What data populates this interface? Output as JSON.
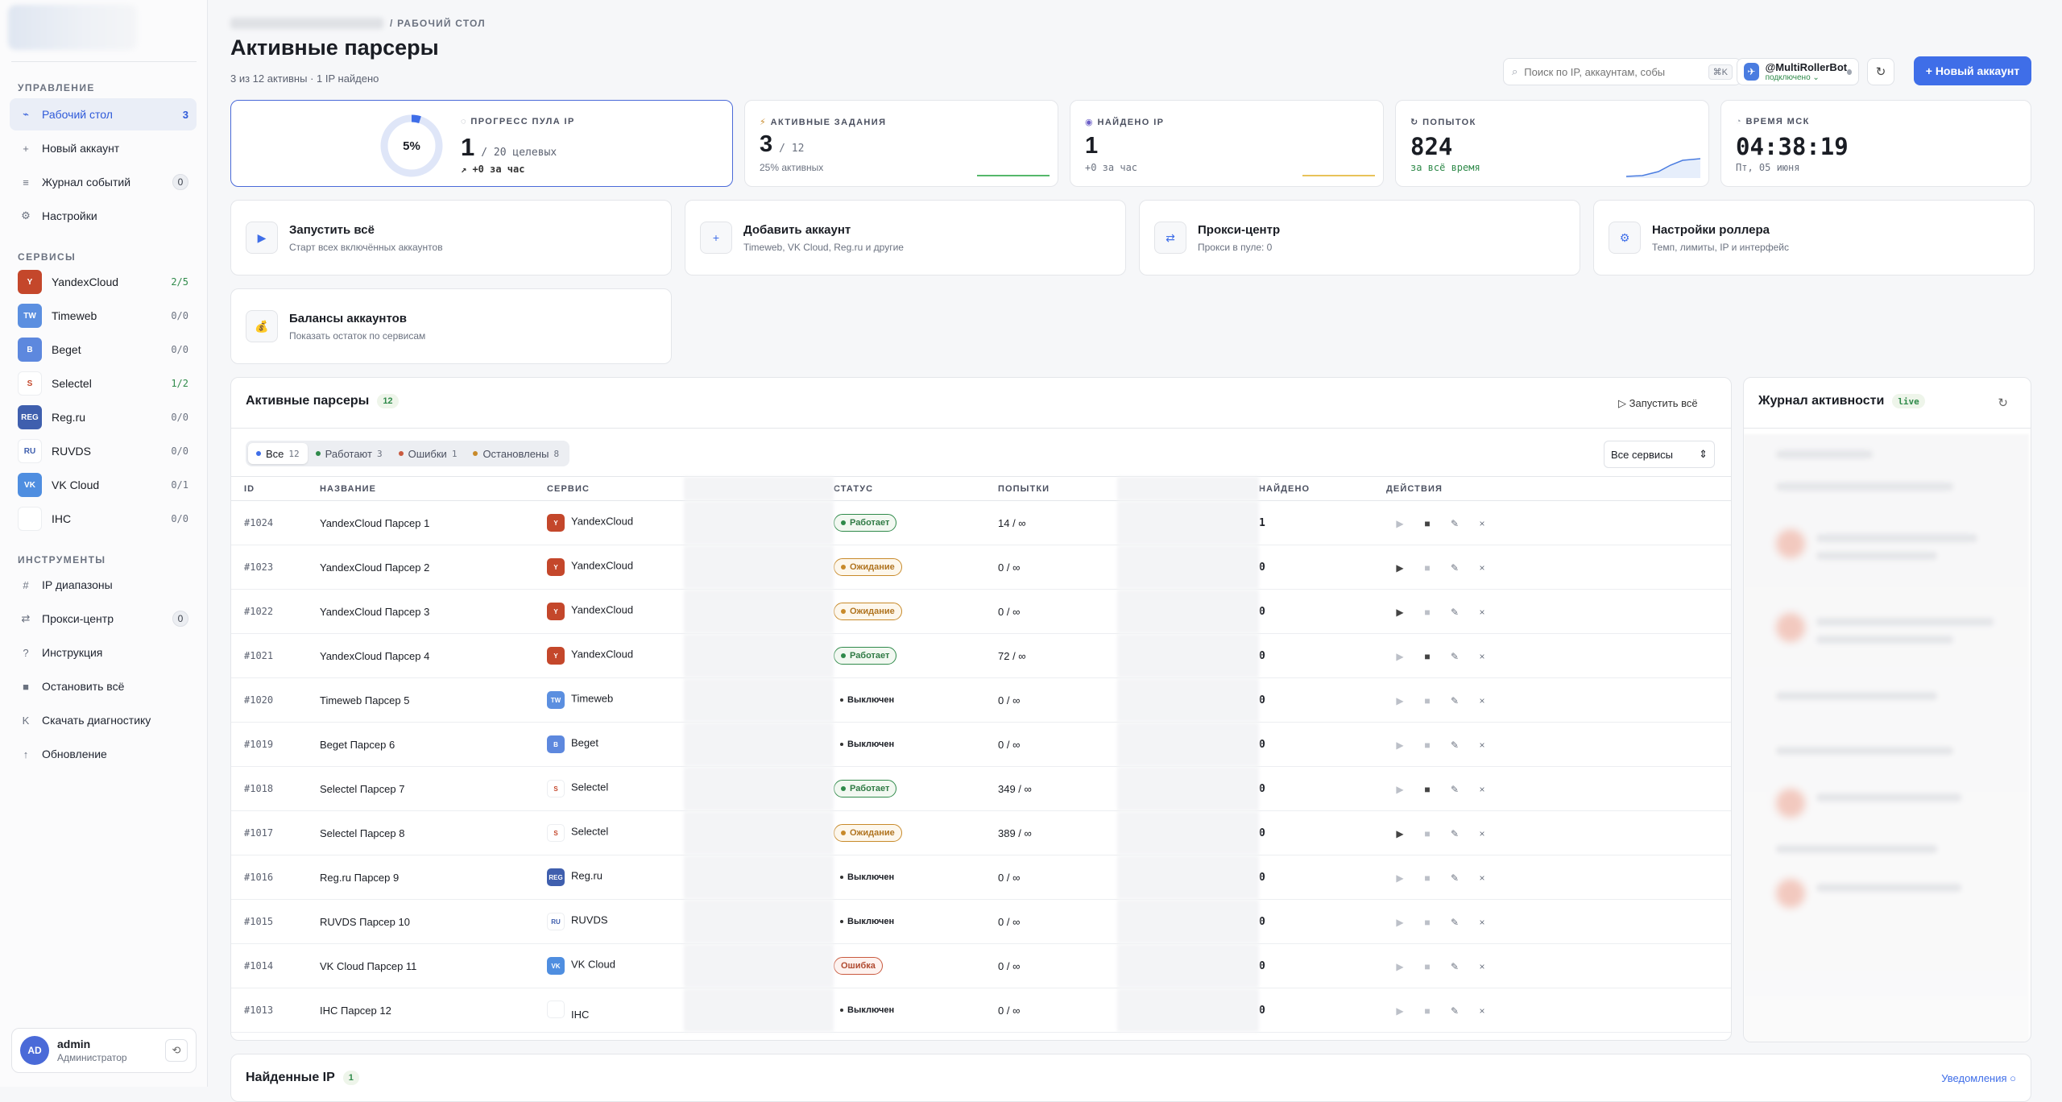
{
  "sidebar": {
    "sections": {
      "manage": "УПРАВЛЕНИЕ",
      "services": "СЕРВИСЫ",
      "tools": "ИНСТРУМЕНТЫ"
    },
    "manage_items": [
      {
        "label": "Рабочий стол",
        "icon": "⌁",
        "count": "3"
      },
      {
        "label": "Новый аккаунт",
        "icon": "+",
        "count": ""
      },
      {
        "label": "Журнал событий",
        "icon": "≡",
        "badge": "0"
      },
      {
        "label": "Настройки",
        "icon": "⚙",
        "count": ""
      }
    ],
    "services": [
      {
        "label": "YandexCloud",
        "abbr": "Y",
        "count": "2/5",
        "color": "#c4472b"
      },
      {
        "label": "Timeweb",
        "abbr": "TW",
        "count": "0/0",
        "color": "#5b8fe0"
      },
      {
        "label": "Beget",
        "abbr": "B",
        "count": "0/0",
        "color": "#5d88de"
      },
      {
        "label": "Selectel",
        "abbr": "S",
        "count": "1/2",
        "color": "#ffffff"
      },
      {
        "label": "Reg.ru",
        "abbr": "REG",
        "count": "0/0",
        "color": "#3f5fae"
      },
      {
        "label": "RUVDS",
        "abbr": "RU",
        "count": "0/0",
        "color": "#ffffff"
      },
      {
        "label": "VK Cloud",
        "abbr": "VK",
        "count": "0/1",
        "color": "#4f8ee0"
      },
      {
        "label": "IHC",
        "abbr": "",
        "count": "0/0",
        "color": "#ffffff"
      }
    ],
    "tools": [
      {
        "label": "IP диапазоны",
        "icon": "#"
      },
      {
        "label": "Прокси-центр",
        "icon": "⇄",
        "badge": "0"
      },
      {
        "label": "Инструкция",
        "icon": "?"
      },
      {
        "label": "Остановить всё",
        "icon": "■"
      },
      {
        "label": "Скачать диагностику",
        "icon": "K"
      },
      {
        "label": "Обновление",
        "icon": "↑"
      }
    ],
    "user": {
      "initials": "AD",
      "name": "admin",
      "role": "Администратор"
    }
  },
  "header": {
    "breadcrumb": "/ РАБОЧИЙ СТОЛ",
    "title": "Активные парсеры",
    "subtitle": "3 из 12 активны · 1 IP найдено",
    "search_placeholder": "Поиск по IP, аккаунтам, собы",
    "search_kbd": "⌘K",
    "bot_name": "@MultiRollerBot",
    "bot_status": "подключено ⌄",
    "new_account": "+ Новый аккаунт"
  },
  "stats": {
    "pool": {
      "label": "ПРОГРЕСС ПУЛА IP",
      "percent": "5%",
      "progress": 0.05,
      "value": "1",
      "target": "/ 20 целевых",
      "delta": "↗ +0 за час"
    },
    "tasks": {
      "label": "АКТИВНЫЕ ЗАДАНИЯ",
      "value": "3",
      "total": "/ 12",
      "sub": "25% активных"
    },
    "found": {
      "label": "НАЙДЕНО IP",
      "value": "1",
      "sub": "+0 за час"
    },
    "attempts": {
      "label": "ПОПЫТОК",
      "value": "824",
      "sub": "за всё время"
    },
    "time": {
      "label": "ВРЕМЯ МСК",
      "value": "04:38:19",
      "sub": "Пт, 05 июня"
    }
  },
  "tiles": [
    {
      "title": "Запустить всё",
      "desc": "Старт всех включённых аккаунтов",
      "icon": "▶"
    },
    {
      "title": "Добавить аккаунт",
      "desc": "Timeweb, VK Cloud, Reg.ru и другие",
      "icon": "+"
    },
    {
      "title": "Прокси-центр",
      "desc": "Прокси в пуле: 0",
      "icon": "⇄"
    },
    {
      "title": "Настройки роллера",
      "desc": "Темп, лимиты, IP и интерфейс",
      "icon": "⚙"
    },
    {
      "title": "Балансы аккаунтов",
      "desc": "Показать остаток по сервисам",
      "icon": "💰"
    }
  ],
  "parsers": {
    "title": "Активные парсеры",
    "count": "12",
    "run_all": "▷ Запустить всё",
    "filters": [
      {
        "label": "Все",
        "count": "12",
        "color": "#3f6ee8"
      },
      {
        "label": "Работают",
        "count": "3",
        "color": "#2f8a4a"
      },
      {
        "label": "Ошибки",
        "count": "1",
        "color": "#c95a3f"
      },
      {
        "label": "Остановлены",
        "count": "8",
        "color": "#c88a2a"
      }
    ],
    "service_select": "Все сервисы",
    "columns": [
      "ID",
      "НАЗВАНИЕ",
      "СЕРВИС",
      "",
      "СТАТУС",
      "ПОПЫТКИ",
      "",
      "НАЙДЕНО",
      "ДЕЙСТВИЯ"
    ],
    "rows": [
      {
        "id": "#1024",
        "name": "YandexCloud Парсер 1",
        "service": "YandexCloud",
        "abbr": "Y",
        "color": "#c4472b",
        "status": "Работает",
        "kind": "run",
        "attempts": "14 / ∞",
        "found": "1"
      },
      {
        "id": "#1023",
        "name": "YandexCloud Парсер 2",
        "service": "YandexCloud",
        "abbr": "Y",
        "color": "#c4472b",
        "status": "Ожидание",
        "kind": "wait",
        "attempts": "0 / ∞",
        "found": "0"
      },
      {
        "id": "#1022",
        "name": "YandexCloud Парсер 3",
        "service": "YandexCloud",
        "abbr": "Y",
        "color": "#c4472b",
        "status": "Ожидание",
        "kind": "wait",
        "attempts": "0 / ∞",
        "found": "0"
      },
      {
        "id": "#1021",
        "name": "YandexCloud Парсер 4",
        "service": "YandexCloud",
        "abbr": "Y",
        "color": "#c4472b",
        "status": "Работает",
        "kind": "run",
        "attempts": "72 / ∞",
        "found": "0"
      },
      {
        "id": "#1020",
        "name": "Timeweb Парсер 5",
        "service": "Timeweb",
        "abbr": "TW",
        "color": "#5b8fe0",
        "status": "Выключен",
        "kind": "off",
        "attempts": "0 / ∞",
        "found": "0"
      },
      {
        "id": "#1019",
        "name": "Beget Парсер 6",
        "service": "Beget",
        "abbr": "B",
        "color": "#5d88de",
        "status": "Выключен",
        "kind": "off",
        "attempts": "0 / ∞",
        "found": "0"
      },
      {
        "id": "#1018",
        "name": "Selectel Парсер 7",
        "service": "Selectel",
        "abbr": "S",
        "color": "#ffffff",
        "status": "Работает",
        "kind": "run",
        "attempts": "349 / ∞",
        "found": "0"
      },
      {
        "id": "#1017",
        "name": "Selectel Парсер 8",
        "service": "Selectel",
        "abbr": "S",
        "color": "#ffffff",
        "status": "Ожидание",
        "kind": "wait",
        "attempts": "389 / ∞",
        "found": "0"
      },
      {
        "id": "#1016",
        "name": "Reg.ru Парсер 9",
        "service": "Reg.ru",
        "abbr": "REG",
        "color": "#3f5fae",
        "status": "Выключен",
        "kind": "off",
        "attempts": "0 / ∞",
        "found": "0"
      },
      {
        "id": "#1015",
        "name": "RUVDS Парсер 10",
        "service": "RUVDS",
        "abbr": "RU",
        "color": "#ffffff",
        "status": "Выключен",
        "kind": "off",
        "attempts": "0 / ∞",
        "found": "0"
      },
      {
        "id": "#1014",
        "name": "VK Cloud Парсер 11",
        "service": "VK Cloud",
        "abbr": "VK",
        "color": "#4f8ee0",
        "status": "Ошибка",
        "kind": "err",
        "attempts": "0 / ∞",
        "found": "0"
      },
      {
        "id": "#1013",
        "name": "IHC Парсер 12",
        "service": "IHC",
        "abbr": "",
        "color": "#ffffff",
        "status": "Выключен",
        "kind": "off",
        "attempts": "0 / ∞",
        "found": "0"
      }
    ]
  },
  "activity": {
    "title": "Журнал активности",
    "pill": "live"
  },
  "found_ips": {
    "title": "Найденные IP",
    "count": "1",
    "link": "Уведомления ○"
  }
}
